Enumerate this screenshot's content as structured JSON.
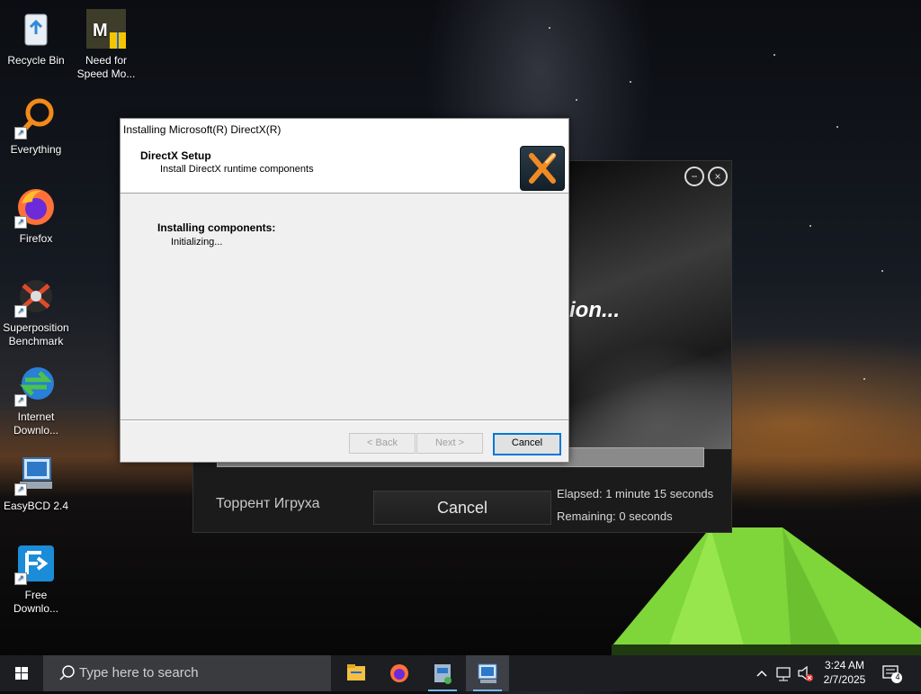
{
  "desktop": {
    "icons": [
      {
        "label": "Recycle Bin",
        "icon": "recycle-bin-icon"
      },
      {
        "label": "Need for Speed Mo...",
        "icon": "need-for-speed-icon"
      },
      {
        "label": "Everything",
        "icon": "everything-search-icon"
      },
      {
        "label": "Firefox",
        "icon": "firefox-icon"
      },
      {
        "label": "Superposition Benchmark",
        "icon": "superposition-benchmark-icon"
      },
      {
        "label": "Internet Downlo...",
        "icon": "internet-download-manager-icon"
      },
      {
        "label": "EasyBCD 2.4",
        "icon": "easybcd-icon"
      },
      {
        "label": "Free Downlo...",
        "icon": "free-download-manager-icon"
      }
    ]
  },
  "bg_installer": {
    "title_fragment": "ion...",
    "label": "Торрент Игруха",
    "cancel_label": "Cancel",
    "elapsed": "Elapsed:  1 minute 15 seconds",
    "remaining": "Remaining:  0 seconds"
  },
  "dialog": {
    "title": "Installing Microsoft(R) DirectX(R)",
    "header_title": "DirectX Setup",
    "header_subtitle": "Install DirectX runtime components",
    "status_heading": "Installing components:",
    "status_detail": "Initializing...",
    "back_label": "< Back",
    "next_label": "Next >",
    "cancel_label": "Cancel"
  },
  "taskbar": {
    "search_placeholder": "Type here to search",
    "apps": [
      {
        "icon": "file-explorer-icon",
        "active": false
      },
      {
        "icon": "firefox-icon",
        "active": false
      },
      {
        "icon": "installer-icon",
        "active": false
      },
      {
        "icon": "directx-setup-icon",
        "active": true
      }
    ],
    "time": "3:24 AM",
    "date": "2/7/2025",
    "notification_count": "4"
  }
}
